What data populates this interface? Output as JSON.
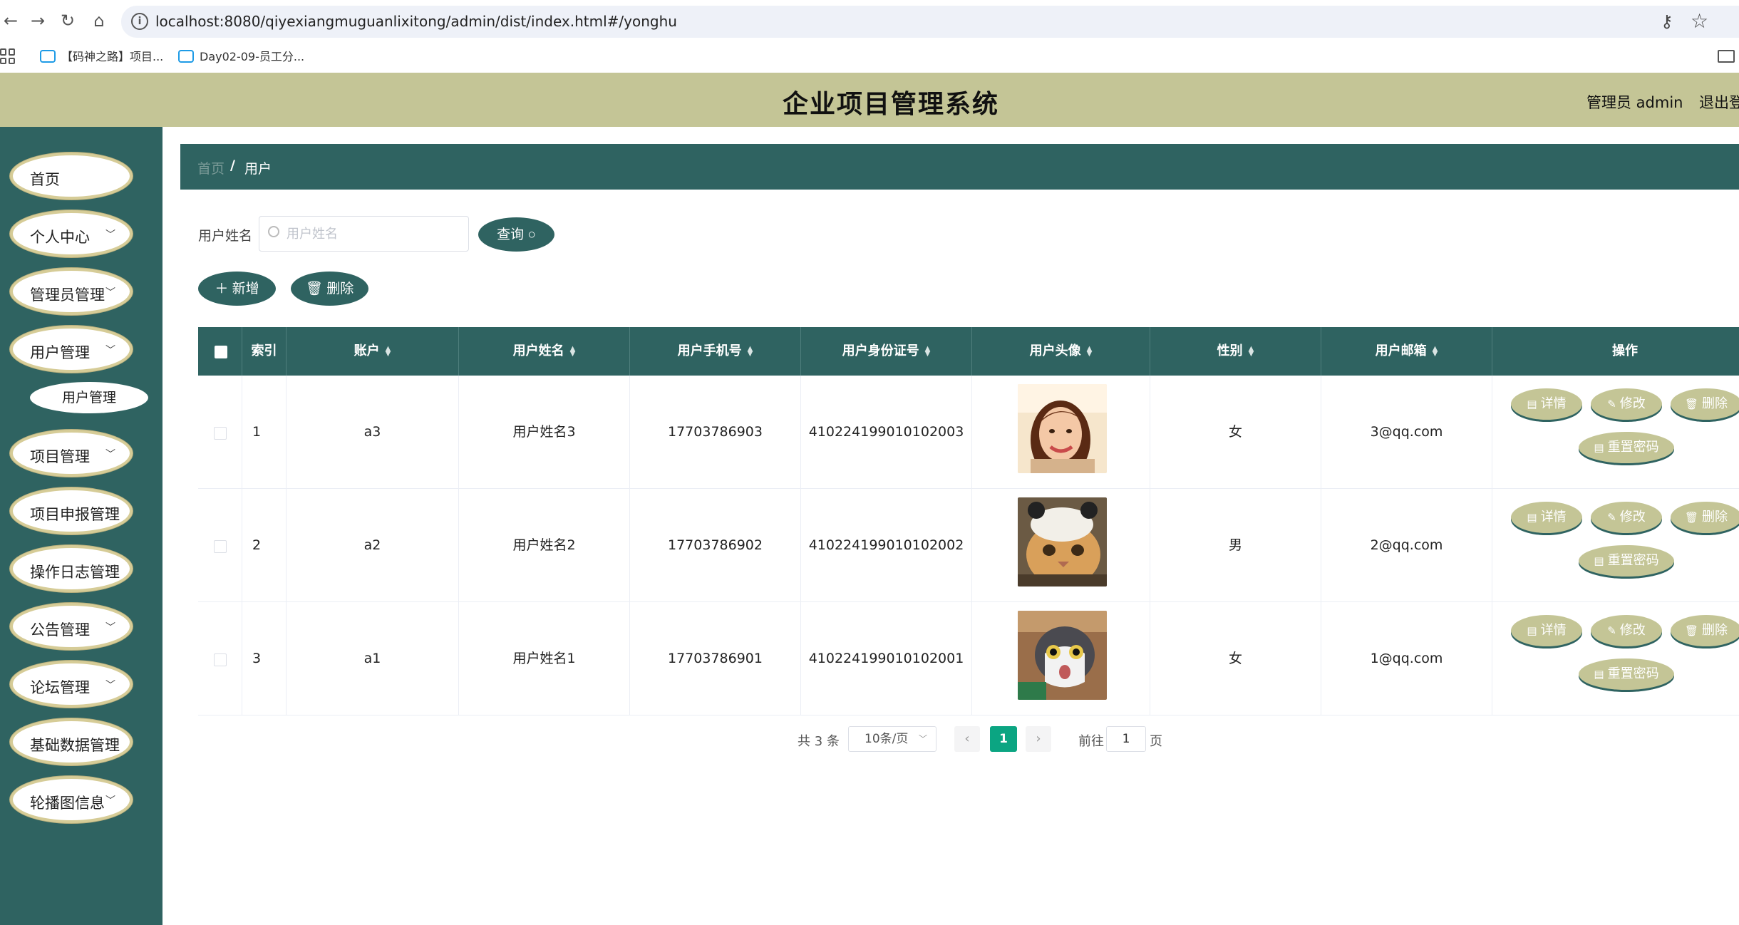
{
  "browser": {
    "url": "localhost:8080/qiyexiangmuguanlixitong/admin/dist/index.html#/yonghu",
    "bookmarks": [
      "【码神之路】项目...",
      "Day02-09-员工分..."
    ]
  },
  "header": {
    "title": "企业项目管理系统",
    "admin_label": "管理员 admin",
    "logout": "退出登"
  },
  "sidebar": {
    "items": [
      {
        "label": "首页",
        "chevron": false
      },
      {
        "label": "个人中心",
        "chevron": true
      },
      {
        "label": "管理员管理",
        "chevron": true
      },
      {
        "label": "用户管理",
        "chevron": true
      },
      {
        "label": "项目管理",
        "chevron": true
      },
      {
        "label": "项目申报管理",
        "chevron": true
      },
      {
        "label": "操作日志管理",
        "chevron": true
      },
      {
        "label": "公告管理",
        "chevron": true
      },
      {
        "label": "论坛管理",
        "chevron": true
      },
      {
        "label": "基础数据管理",
        "chevron": true
      },
      {
        "label": "轮播图信息",
        "chevron": true
      }
    ],
    "submenu_label": "用户管理"
  },
  "breadcrumb": {
    "home": "首页",
    "separator": "/",
    "current": "用户"
  },
  "search": {
    "label": "用户姓名",
    "placeholder": "用户姓名",
    "value": "",
    "button": "查询"
  },
  "toolbar": {
    "add": "新增",
    "delete": "删除"
  },
  "table": {
    "columns": [
      "索引",
      "账户",
      "用户姓名",
      "用户手机号",
      "用户身份证号",
      "用户头像",
      "性别",
      "用户邮箱",
      "操作"
    ],
    "rows": [
      {
        "index": "1",
        "account": "a3",
        "name": "用户姓名3",
        "phone": "17703786903",
        "id_card": "410224199010102003",
        "avatar": "woman-photo",
        "gender": "女",
        "email": "3@qq.com"
      },
      {
        "index": "2",
        "account": "a2",
        "name": "用户姓名2",
        "phone": "17703786902",
        "id_card": "410224199010102002",
        "avatar": "cat-with-hat-photo",
        "gender": "男",
        "email": "2@qq.com"
      },
      {
        "index": "3",
        "account": "a1",
        "name": "用户姓名1",
        "phone": "17703786901",
        "id_card": "410224199010102001",
        "avatar": "surprised-cat-photo",
        "gender": "女",
        "email": "1@qq.com"
      }
    ],
    "actions": {
      "detail": "详情",
      "edit": "修改",
      "delete": "删除",
      "reset": "重置密码"
    }
  },
  "pagination": {
    "total": "共 3 条",
    "page_size": "10条/页",
    "current": "1",
    "goto_label": "前往",
    "goto_value": "1",
    "goto_suffix": "页"
  },
  "colors": {
    "primary": "#2f6361",
    "header_bg": "#c4c596",
    "action_btn": "#c4c596",
    "page_active": "#0ba582"
  }
}
